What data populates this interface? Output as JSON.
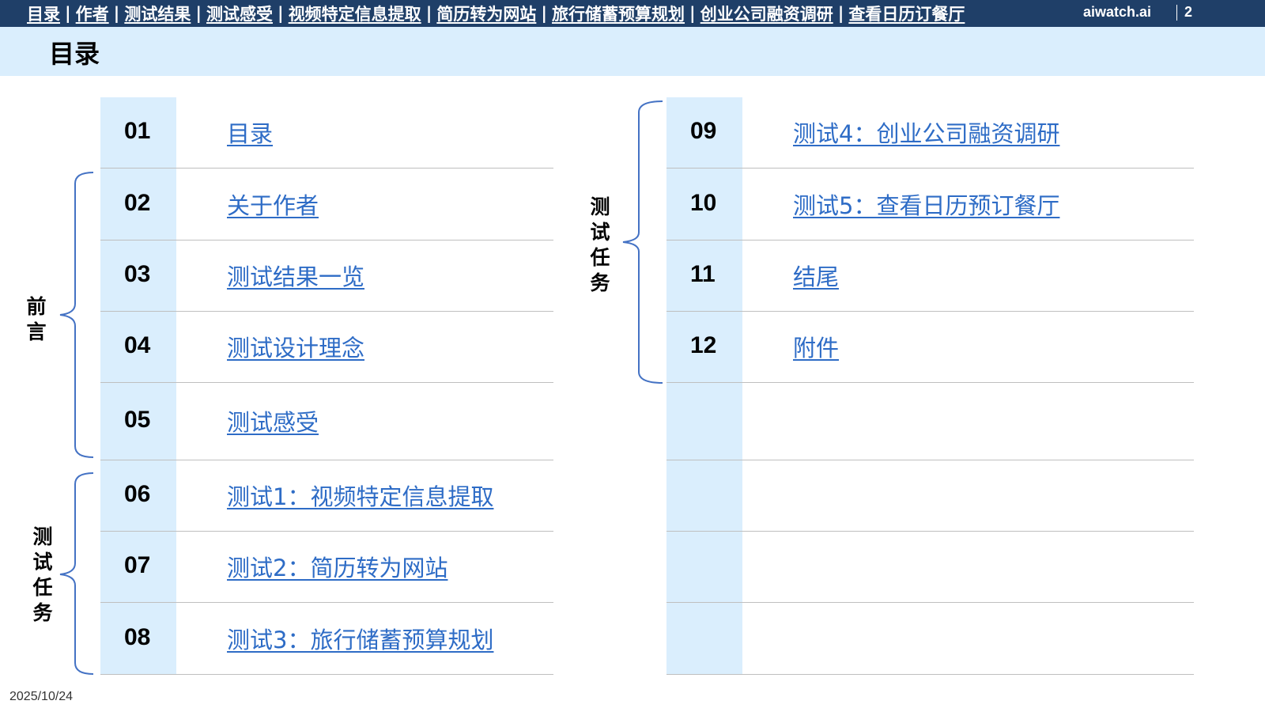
{
  "nav": {
    "links": [
      "目录",
      "作者",
      "测试结果",
      "测试感受",
      "视频特定信息提取",
      "简历转为网站",
      "旅行储蓄预算规划",
      "创业公司融资调研",
      "查看日历订餐厅"
    ],
    "separator": "|",
    "brand": "aiwatch.ai",
    "page_number": "2"
  },
  "title": "目录",
  "left_table": [
    {
      "num": "01",
      "label": "目录"
    },
    {
      "num": "02",
      "label": "关于作者"
    },
    {
      "num": "03",
      "label": "测试结果一览"
    },
    {
      "num": "04",
      "label": "测试设计理念"
    },
    {
      "num": "05",
      "label": "测试感受"
    },
    {
      "num": "06",
      "label": "测试1：视频特定信息提取"
    },
    {
      "num": "07",
      "label": "测试2：简历转为网站"
    },
    {
      "num": "08",
      "label": "测试3：旅行储蓄预算规划"
    }
  ],
  "right_table": [
    {
      "num": "09",
      "label": "测试4：创业公司融资调研"
    },
    {
      "num": "10",
      "label": "测试5：查看日历预订餐厅"
    },
    {
      "num": "11",
      "label": "结尾"
    },
    {
      "num": "12",
      "label": "附件"
    },
    {
      "num": "",
      "label": ""
    },
    {
      "num": "",
      "label": ""
    },
    {
      "num": "",
      "label": ""
    },
    {
      "num": "",
      "label": ""
    }
  ],
  "brackets": {
    "preface": "前言",
    "test_tasks_left": "测试任务",
    "test_tasks_right": "测试任务"
  },
  "colors": {
    "nav_bg": "#1f3f68",
    "title_band": "#daeefd",
    "link": "#2e6cc6",
    "bracket": "#4472c4"
  },
  "footer": {
    "date": "2025/10/24"
  }
}
